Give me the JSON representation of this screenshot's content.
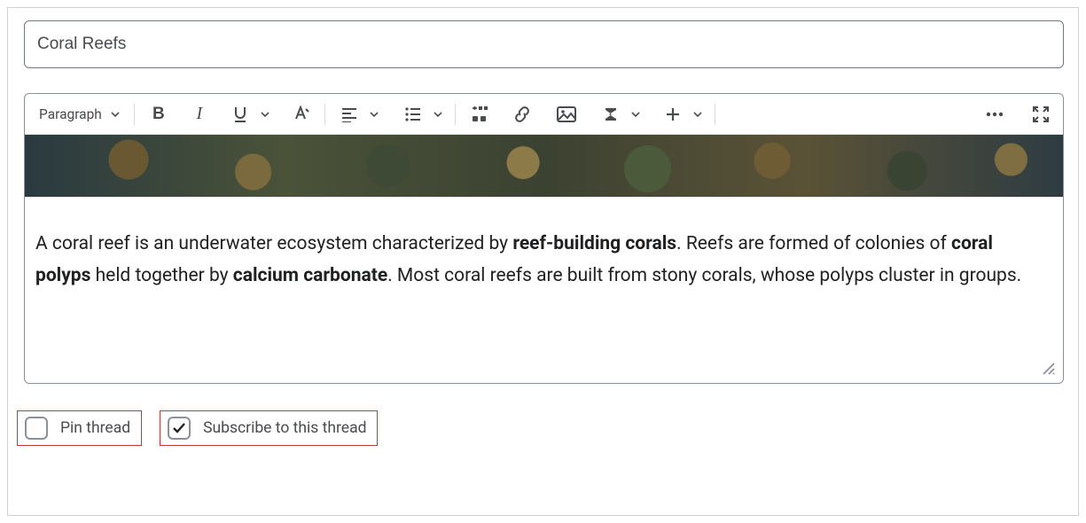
{
  "title_input": {
    "value": "Coral Reefs"
  },
  "toolbar": {
    "format_label": "Paragraph"
  },
  "body": {
    "text_before_b1": "A coral reef is an underwater ecosystem characterized by ",
    "b1": "reef-building corals",
    "text_after_b1": ". Reefs are formed of colonies of ",
    "b2": "coral polyps",
    "text_mid": " held together by ",
    "b3": "calcium carbonate",
    "text_after_b3": ". Most coral reefs are built from stony corals, whose polyps cluster in groups."
  },
  "options": {
    "pin": {
      "label": "Pin thread",
      "checked": false
    },
    "subscribe": {
      "label": "Subscribe to this thread",
      "checked": true
    }
  }
}
